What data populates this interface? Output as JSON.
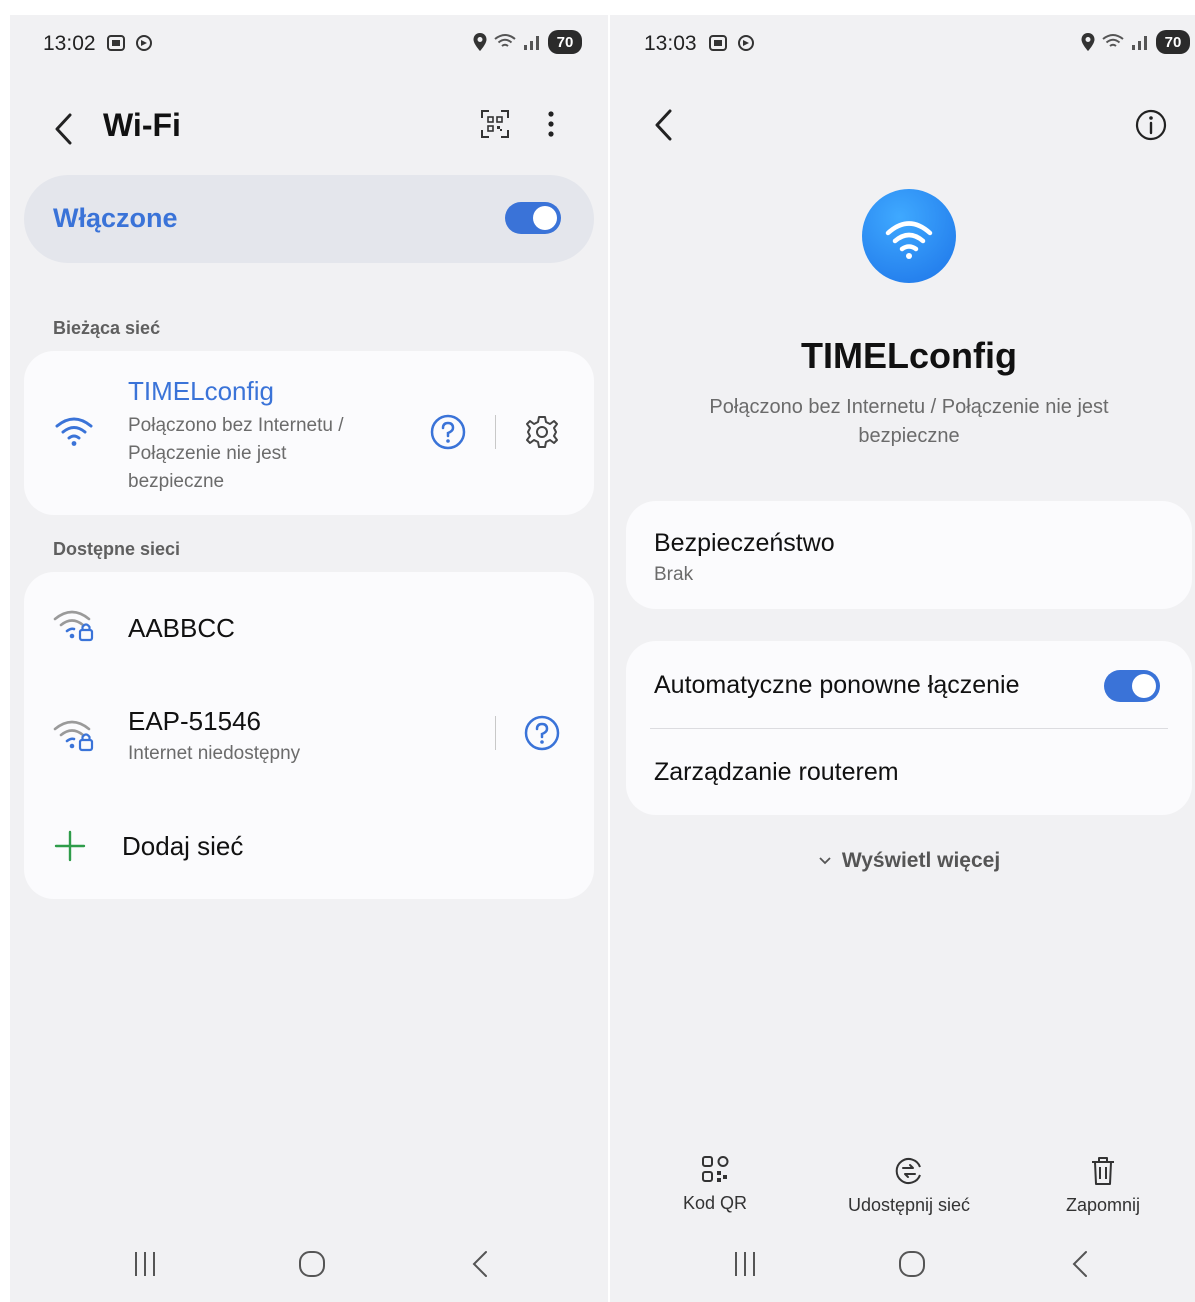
{
  "left": {
    "status": {
      "time": "13:02",
      "battery": "70"
    },
    "header": {
      "title": "Wi-Fi"
    },
    "toggle": {
      "label": "Włączone"
    },
    "current": {
      "section_label": "Bieżąca sieć",
      "network_name": "TIMELconfig",
      "status_line1": "Połączono bez Internetu /",
      "status_line2": "Połączenie nie jest",
      "status_line3": "bezpieczne"
    },
    "available": {
      "section_label": "Dostępne sieci",
      "networks": [
        {
          "name": "AABBCC",
          "status": ""
        },
        {
          "name": "EAP-51546",
          "status": "Internet niedostępny"
        }
      ],
      "add_label": "Dodaj sieć"
    }
  },
  "right": {
    "status": {
      "time": "13:03",
      "battery": "70"
    },
    "network_name": "TIMELconfig",
    "status_line1": "Połączono bez Internetu / Połączenie nie jest",
    "status_line2": "bezpieczne",
    "security": {
      "title": "Bezpieczeństwo",
      "value": "Brak"
    },
    "auto_reconnect": {
      "label": "Automatyczne ponowne łączenie",
      "enabled": true
    },
    "router_label": "Zarządzanie routerem",
    "show_more": "Wyświetl więcej",
    "actions": [
      {
        "label": "Kod QR",
        "icon": "qr-code-icon"
      },
      {
        "label": "Udostępnij sieć",
        "icon": "share-network-icon"
      },
      {
        "label": "Zapomnij",
        "icon": "trash-icon"
      }
    ]
  },
  "colors": {
    "accent": "#3a73d8",
    "background": "#f1f1f3",
    "card": "#fbfbfd",
    "add_green": "#2e9c4a"
  }
}
